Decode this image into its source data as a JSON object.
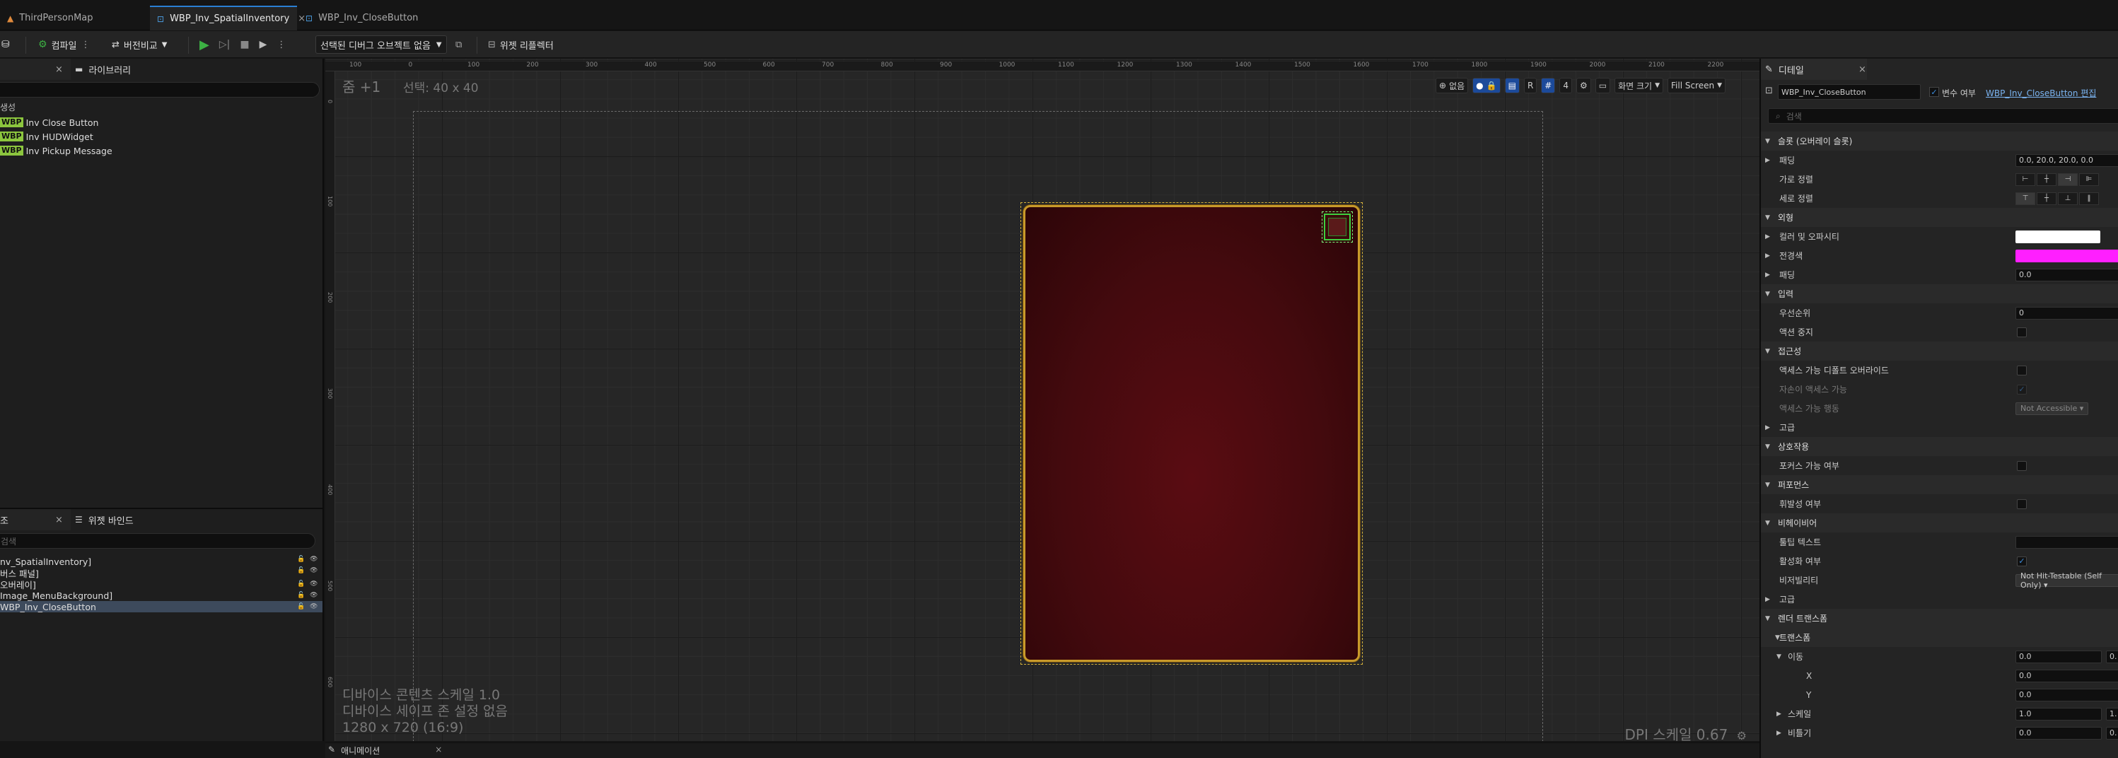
{
  "tabs": [
    {
      "label": "ThirdPersonMap",
      "active": false
    },
    {
      "label": "WBP_Inv_SpatialInventory",
      "active": true
    },
    {
      "label": "WBP_Inv_CloseButton",
      "active": false
    }
  ],
  "toolbar": {
    "compile": "컴파일",
    "diff": "버전비교",
    "debug_select": "선택된 디버그 오브젝트 없음",
    "widget_reflector": "위젯 리플렉터"
  },
  "left": {
    "tab_palette": "",
    "tab_library": "라이브러리",
    "section": "생성",
    "items": [
      "Inv Close Button",
      "Inv HUDWidget",
      "Inv Pickup Message"
    ],
    "wbp_badge": "WBP"
  },
  "hierarchy": {
    "tab_label": "조",
    "tab_binding": "위젯 바인드",
    "search_placeholder": "검색",
    "rows": [
      "nv_SpatialInventory]",
      "버스 패널]",
      "오버레이]",
      "Image_MenuBackground]",
      "WBP_Inv_CloseButton"
    ]
  },
  "canvas": {
    "zoom": "줌 +1",
    "selection": "선택: 40 x 40",
    "ruler": [
      "100",
      "0",
      "100",
      "200",
      "300",
      "400",
      "500",
      "600",
      "700",
      "800",
      "900",
      "1000",
      "1100",
      "1200",
      "1300",
      "1400",
      "1500",
      "1600",
      "1700",
      "1800",
      "1900",
      "2000",
      "2100",
      "2200"
    ],
    "view_none": "없음",
    "view_r": "R",
    "view_grid": "4",
    "screen_size": "화면 크기",
    "fill_screen": "Fill Screen",
    "device_scale": "디바이스 콘텐츠 스케일 1.0",
    "safe_zone": "디바이스 세이프 존 설정 없음",
    "resolution": "1280 x 720 (16:9)",
    "dpi": "DPI 스케일 0.67"
  },
  "bottom": {
    "animation": "애니메이션"
  },
  "details": {
    "tab": "디테일",
    "name": "WBP_Inv_CloseButton",
    "is_variable_label": "변수 여부",
    "edit_link": "WBP_Inv_CloseButton 편집",
    "search_placeholder": "검색",
    "rows": [
      {
        "type": "section",
        "label": "슬롯 (오버레이 슬롯)"
      },
      {
        "type": "value",
        "label": "패딩",
        "value": "0.0, 20.0, 20.0, 0.0",
        "expand": true
      },
      {
        "type": "align",
        "label": "가로 정렬"
      },
      {
        "type": "align",
        "label": "세로 정렬"
      },
      {
        "type": "section",
        "label": "외형"
      },
      {
        "type": "color",
        "label": "컬러 및 오파시티",
        "value": "#ffffff",
        "expand": true
      },
      {
        "type": "color",
        "label": "전경색",
        "value": "#ff1fff",
        "expand": true
      },
      {
        "type": "value",
        "label": "패딩",
        "value": "0.0",
        "expand": true
      },
      {
        "type": "section",
        "label": "입력"
      },
      {
        "type": "value",
        "label": "우선순위",
        "value": "0"
      },
      {
        "type": "check",
        "label": "액션 중지",
        "checked": false
      },
      {
        "type": "section",
        "label": "접근성"
      },
      {
        "type": "check",
        "label": "액세스 가능 디폴트 오버라이드",
        "checked": false
      },
      {
        "type": "check",
        "label": "자손이 액세스 가능",
        "checked": true,
        "dim": true
      },
      {
        "type": "dropdown",
        "label": "액세스 가능 행동",
        "value": "Not Accessible",
        "dim": true
      },
      {
        "type": "subsection",
        "label": "고급"
      },
      {
        "type": "section",
        "label": "상호작용"
      },
      {
        "type": "check",
        "label": "포커스 가능 여부",
        "checked": false
      },
      {
        "type": "section",
        "label": "퍼포먼스"
      },
      {
        "type": "check",
        "label": "휘발성 여부",
        "checked": false
      },
      {
        "type": "section",
        "label": "비헤이비어"
      },
      {
        "type": "value",
        "label": "툴팁 텍스트",
        "value": ""
      },
      {
        "type": "check",
        "label": "활성화 여부",
        "checked": true
      },
      {
        "type": "dropdown",
        "label": "비저빌리티",
        "value": "Not Hit-Testable (Self Only)"
      },
      {
        "type": "subsection",
        "label": "고급"
      },
      {
        "type": "section",
        "label": "렌더 트랜스폼"
      },
      {
        "type": "section2",
        "label": "트랜스폼"
      },
      {
        "type": "value",
        "label": "이동",
        "value": "0.0",
        "expand": true,
        "value2": "0."
      },
      {
        "type": "value",
        "label": "X",
        "value": "0.0",
        "indent": true
      },
      {
        "type": "value",
        "label": "Y",
        "value": "0.0",
        "indent": true
      },
      {
        "type": "value",
        "label": "스케일",
        "value": "1.0",
        "expand": true,
        "value2": "1."
      },
      {
        "type": "value",
        "label": "비틀기",
        "value": "0.0",
        "expand": true,
        "value2": "0."
      }
    ]
  }
}
